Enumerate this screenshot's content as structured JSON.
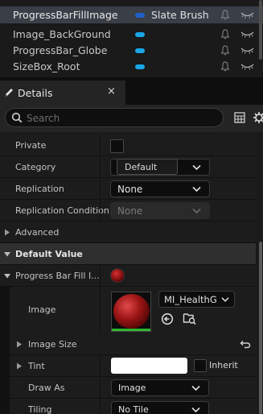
{
  "outliner": {
    "rows": [
      {
        "name": "ProgressBarFillImage",
        "tag": "Slate Brush"
      },
      {
        "name": "Image_BackGround",
        "tag": ""
      },
      {
        "name": "ProgressBar_Globe",
        "tag": ""
      },
      {
        "name": "SizeBox_Root",
        "tag": ""
      }
    ]
  },
  "details_tab": {
    "label": "Details",
    "close": "×"
  },
  "search": {
    "placeholder": "Search"
  },
  "properties": {
    "private_label": "Private",
    "category_label": "Category",
    "category_tooltip": "Default",
    "replication_label": "Replication",
    "replication_value": "None",
    "replication_condition_label": "Replication Condition",
    "replication_condition_value": "None",
    "advanced_label": "Advanced",
    "default_value_label": "Default Value",
    "fill_label": "Progress Bar Fill I...",
    "image_label": "Image",
    "image_asset": "MI_HealthGl",
    "image_size_label": "Image Size",
    "tint_label": "Tint",
    "inherit_label": "Inherit",
    "draw_as_label": "Draw As",
    "draw_as_value": "Image",
    "tiling_label": "Tiling",
    "tiling_value": "No Tile"
  },
  "colors": {
    "selection": "#3a3f47",
    "pill": "#19a7e6",
    "accent_green": "#2fb62f",
    "tint": "#ffffff"
  }
}
